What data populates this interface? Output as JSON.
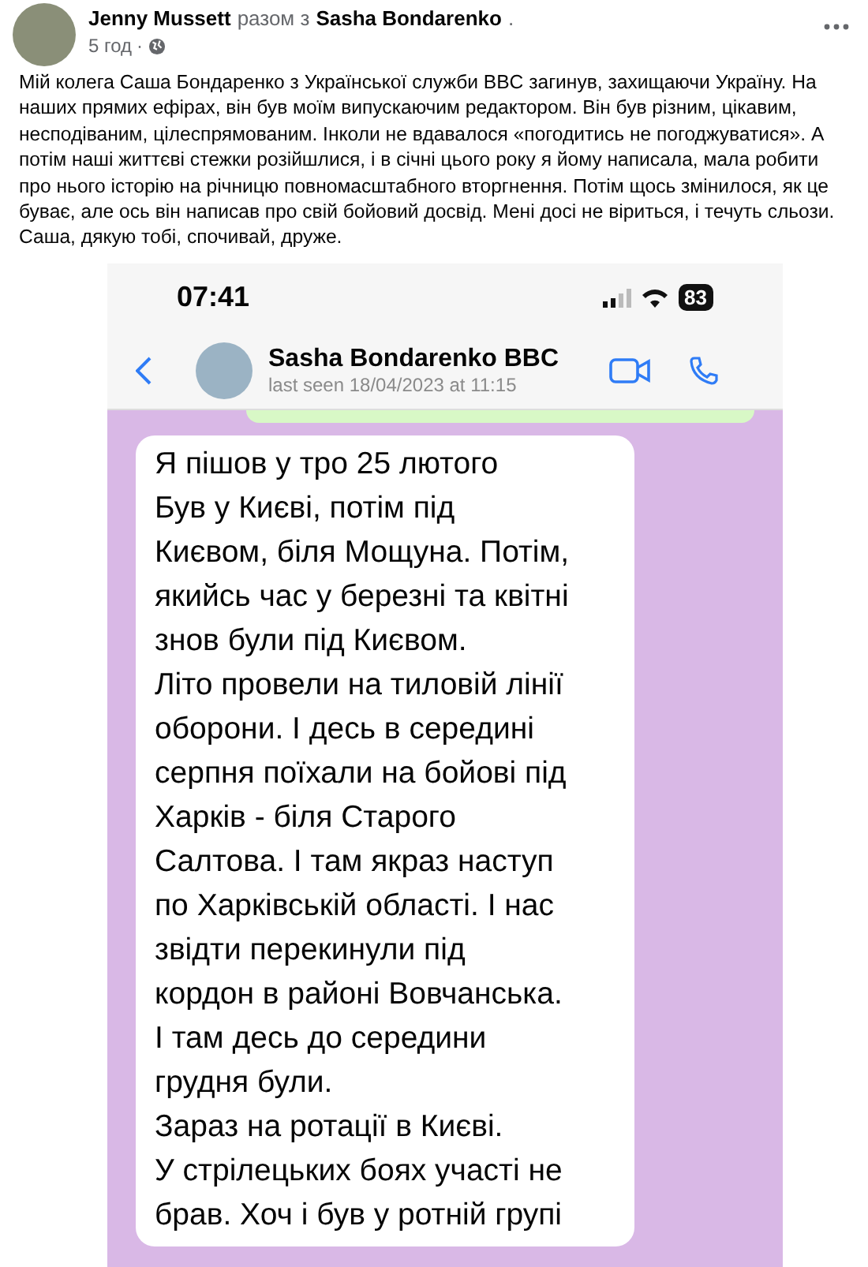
{
  "post": {
    "author": "Jenny Mussett",
    "with_text": "разом з",
    "tagged": "Sasha Bondarenko",
    "tagged_end": ".",
    "time": "5 год",
    "separator": "·",
    "text": "Мій колега Саша Бондаренко з Української служби BBC загинув, захищаючи Україну. На наших прямих ефірах, він був моїм випускаючим редактором. Він був різним, цікавим, несподіваним, цілеспрямованим. Інколи не вдавалося «погодитись не погоджуватися». А потім наші життєві стежки розійшлися, і в січні цього року я йому написала, мала робити про нього історію на річницю повномасштабного вторгнення. Потім щось змінилося, як це буває, але ось він написав про свій бойовий досвід. Мені досі не віриться, і течуть сльози. Саша, дякую тобі, спочивай, друже."
  },
  "phone": {
    "time": "07:41",
    "battery": "83",
    "contact": "Sasha Bondarenko BBC",
    "last_seen": "last seen 18/04/2023 at 11:15",
    "message_lines": [
      "Я пішов у тро 25 лютого",
      "Був у Києві, потім під",
      "Києвом, біля Мощуна. Потім,",
      "якийсь час у березні та квітні",
      "знов були під Києвом.",
      "Літо провели на тиловій лінії",
      "оборони. І десь в середині",
      "серпня поїхали на бойові під",
      "Харків - біля Старого",
      "Салтова. І там якраз наступ",
      "по Харківській області. І нас",
      "звідти перекинули під",
      "кордон в районі Вовчанська.",
      "І там десь до середини",
      "грудня були.",
      "Зараз на ротації в Києві.",
      "У стрілецьких боях участі не",
      "брав. Хоч і був у ротній групі"
    ]
  }
}
